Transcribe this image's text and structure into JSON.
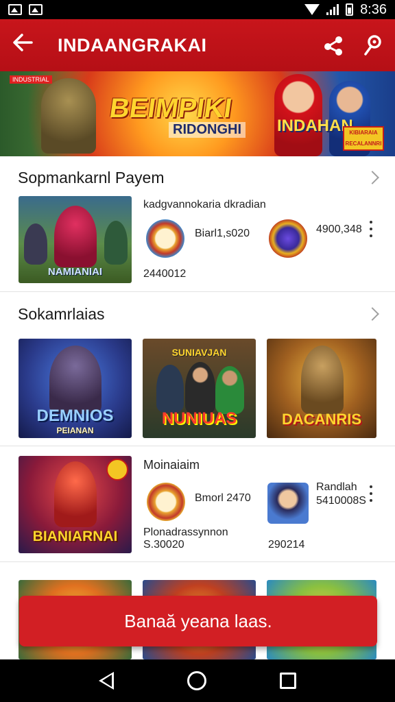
{
  "status_bar": {
    "time": "8:36"
  },
  "app_bar": {
    "title": "INDAANGRAKAI"
  },
  "banner": {
    "tag": "INDUSTRIAL",
    "title": "BEIMPIKI",
    "subtitle": "RIDONGHI",
    "right_title": "INDAHAN",
    "badge": "KIBIARAIA RECALANNRI"
  },
  "section1": {
    "title": "Sopmankarnl Payem",
    "thumb_label": "NAMIANIAI",
    "desc": "kadgvannokaria dkradian",
    "item1_value": "Biarl1,s020",
    "item2_value": "4900,348",
    "date": "2440012"
  },
  "section2": {
    "title": "Sokamrlaias",
    "tiles": [
      {
        "label": "DEMNIOS",
        "sub": "PEIANAN"
      },
      {
        "label": "NUNIUAS",
        "sub": "SUNIAVJAN"
      },
      {
        "label": "DACANRIS",
        "sub": ""
      }
    ]
  },
  "section3": {
    "title": "Moinaiaim",
    "thumb_label": "BIANIARNAI",
    "item1_value": "Bmorl 2470",
    "item2_name": "Randlah",
    "item2_value": "5410008S",
    "desc": "Plonadrassynnon",
    "value2": "S.30020",
    "date2": "290214"
  },
  "fab": {
    "label": "Banaă yeana laas."
  },
  "colors": {
    "brand_red": "#c8151b",
    "accent_gold": "#ffd52e"
  },
  "icons": {
    "back": "arrow-left-icon",
    "share": "share-icon",
    "location": "location-pin-icon",
    "chevron": "chevron-right-icon",
    "more": "more-vertical-icon"
  }
}
